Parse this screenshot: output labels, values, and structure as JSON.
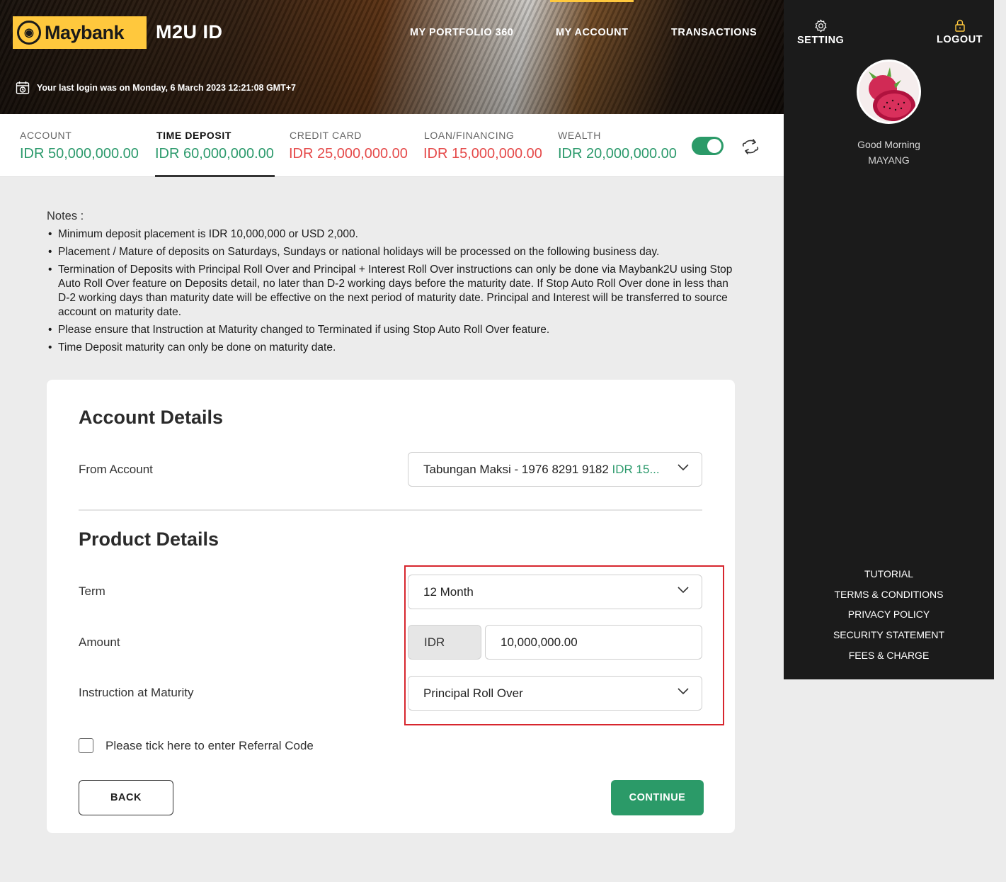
{
  "header": {
    "brand": "Maybank",
    "app_name": "M2U ID",
    "nav": [
      "MY PORTFOLIO 360",
      "MY ACCOUNT",
      "TRANSACTIONS"
    ],
    "last_login": "Your last login was on Monday, 6 March 2023 12:21:08 GMT+7"
  },
  "tabs": [
    {
      "label": "ACCOUNT",
      "value": "IDR 50,000,000.00",
      "color": "#2c9a6c"
    },
    {
      "label": "TIME DEPOSIT",
      "value": "IDR 60,000,000.00",
      "color": "#2c9a6c"
    },
    {
      "label": "CREDIT CARD",
      "value": "IDR 25,000,000.00",
      "color": "#e54a4a"
    },
    {
      "label": "LOAN/FINANCING",
      "value": "IDR 15,000,000.00",
      "color": "#e54a4a"
    },
    {
      "label": "WEALTH",
      "value": "IDR 20,000,000.00",
      "color": "#2c9a6c"
    }
  ],
  "sidebar": {
    "setting": "SETTING",
    "logout": "LOGOUT",
    "greeting": "Good Morning",
    "user_name": "MAYANG",
    "links": [
      "TUTORIAL",
      "TERMS & CONDITIONS",
      "PRIVACY POLICY",
      "SECURITY STATEMENT",
      "FEES & CHARGE"
    ]
  },
  "notes": {
    "title": "Notes :",
    "items": [
      "Minimum deposit placement is IDR 10,000,000 or USD 2,000.",
      "Placement / Mature of deposits on Saturdays, Sundays or national holidays will be processed on the following business day.",
      "Termination of Deposits with Principal Roll Over and Principal + Interest Roll Over instructions can only be done via Maybank2U using Stop Auto Roll Over feature on Deposits detail, no later than D-2 working days before the maturity date. If Stop Auto Roll Over done in less than D-2 working days than maturity date will be effective on the next period of maturity date. Principal and Interest will be transferred to source account on maturity date.",
      "Please ensure that Instruction at Maturity changed to Terminated if using Stop Auto Roll Over feature.",
      "Time Deposit maturity can only be done on maturity date."
    ]
  },
  "form": {
    "account_details_title": "Account Details",
    "from_account_label": "From Account",
    "from_account_value": "Tabungan Maksi - 1976 8291 9182",
    "from_account_balance": "IDR 15...",
    "product_details_title": "Product Details",
    "term_label": "Term",
    "term_value": "12 Month",
    "amount_label": "Amount",
    "currency": "IDR",
    "amount_value": "10,000,000.00",
    "maturity_label": "Instruction at Maturity",
    "maturity_value": "Principal Roll Over",
    "referral_label": "Please tick here to enter Referral Code",
    "back_label": "BACK",
    "continue_label": "CONTINUE"
  },
  "colors": {
    "accent_green": "#2b9a68",
    "negative_red": "#e54a4a",
    "brand_yellow": "#ffc83d",
    "highlight_red": "#d7262e"
  }
}
